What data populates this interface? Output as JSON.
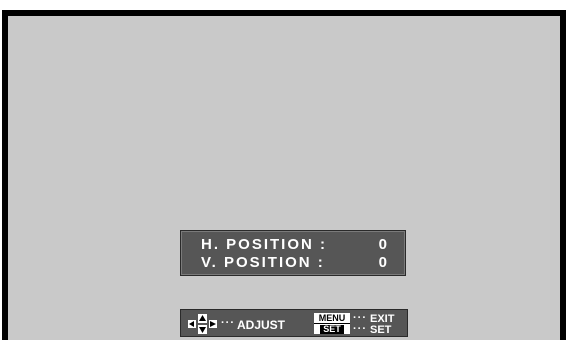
{
  "osd": {
    "rows": [
      {
        "label": "H. POSITION :",
        "value": "0"
      },
      {
        "label": "V. POSITION :",
        "value": "0"
      }
    ]
  },
  "hints": {
    "dots": "···",
    "adjust_label": "ADJUST",
    "menu_key": "MENU",
    "set_key": "SET",
    "exit_label": "EXIT",
    "set_label": "SET",
    "icons": [
      "left-arrow-key-icon",
      "up-arrow-key-icon",
      "down-arrow-key-icon",
      "right-arrow-key-icon"
    ]
  },
  "colors": {
    "screen_bg": "#c9c9c9",
    "osd_bg": "#565656",
    "osd_text": "#ffffff"
  }
}
